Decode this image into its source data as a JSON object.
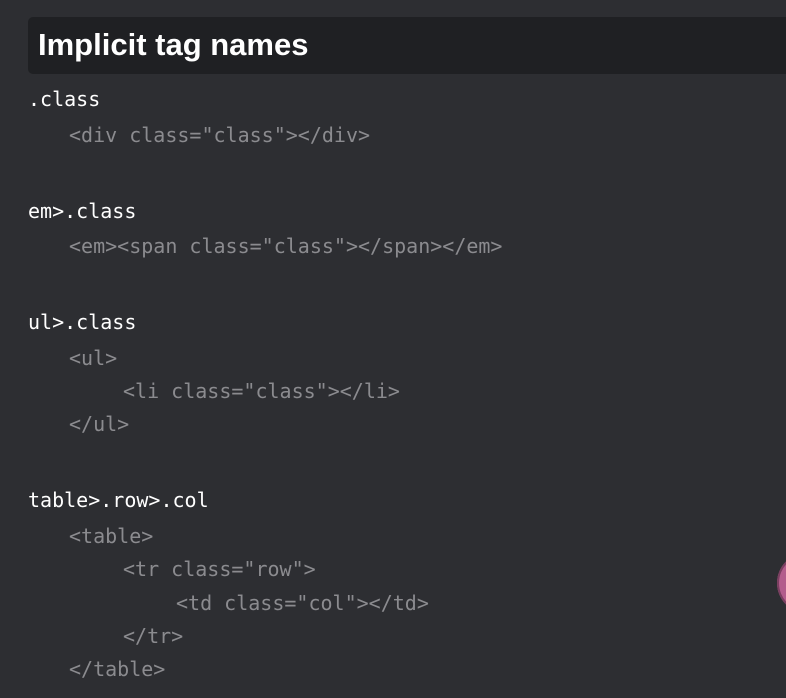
{
  "section": {
    "title": "Implicit tag names"
  },
  "examples": [
    {
      "abbreviation": ".class",
      "output": [
        "<div class=\"class\"></div>"
      ]
    },
    {
      "abbreviation": "em>.class",
      "output": [
        "<em><span class=\"class\"></span></em>"
      ]
    },
    {
      "abbreviation": "ul>.class",
      "output": [
        "<ul>",
        "<li class=\"class\"></li>",
        "</ul>"
      ]
    },
    {
      "abbreviation": "table>.row>.col",
      "output": [
        "<table>",
        "<tr class=\"row\">",
        "<td class=\"col\"></td>",
        "</tr>",
        "</table>"
      ]
    }
  ],
  "colors": {
    "background": "#2d2e32",
    "heading_background": "#1f2023",
    "abbreviation_text": "#ffffff",
    "output_text": "#8b8b8f",
    "floating_button": "#b35d8c"
  }
}
